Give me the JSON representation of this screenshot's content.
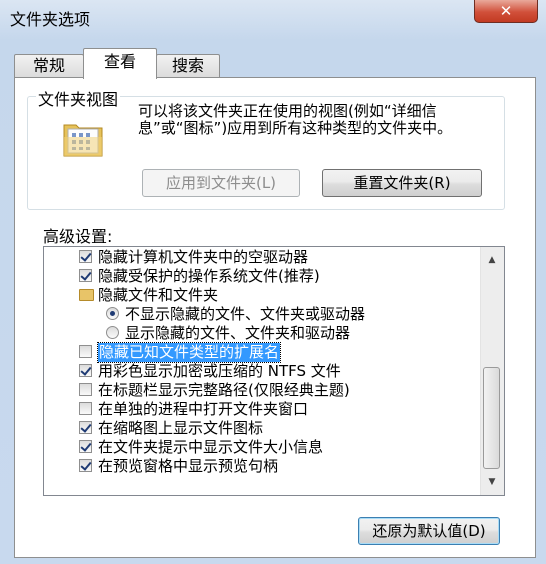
{
  "window": {
    "title": "文件夹选项",
    "close_glyph": "✕"
  },
  "tabs": [
    {
      "label": "常规",
      "active": false
    },
    {
      "label": "查看",
      "active": true
    },
    {
      "label": "搜索",
      "active": false
    }
  ],
  "folder_views": {
    "legend": "文件夹视图",
    "description": "可以将该文件夹正在使用的视图(例如“详细信息”或“图标”)应用到所有这种类型的文件夹中。",
    "apply_button": "应用到文件夹(L)",
    "reset_button": "重置文件夹(R)"
  },
  "advanced": {
    "label": "高级设置:",
    "items": [
      {
        "type": "checkbox",
        "checked": true,
        "indent": 1,
        "label": "隐藏计算机文件夹中的空驱动器"
      },
      {
        "type": "checkbox",
        "checked": true,
        "indent": 1,
        "label": "隐藏受保护的操作系统文件(推荐)"
      },
      {
        "type": "folder",
        "indent": 1,
        "label": "隐藏文件和文件夹"
      },
      {
        "type": "radio",
        "selected": true,
        "indent": 2,
        "label": "不显示隐藏的文件、文件夹或驱动器"
      },
      {
        "type": "radio",
        "selected": false,
        "indent": 2,
        "label": "显示隐藏的文件、文件夹和驱动器"
      },
      {
        "type": "checkbox",
        "checked": false,
        "indent": 1,
        "label": "隐藏已知文件类型的扩展名",
        "highlight": true
      },
      {
        "type": "checkbox",
        "checked": true,
        "indent": 1,
        "label": "用彩色显示加密或压缩的 NTFS 文件"
      },
      {
        "type": "checkbox",
        "checked": false,
        "indent": 1,
        "label": "在标题栏显示完整路径(仅限经典主题)"
      },
      {
        "type": "checkbox",
        "checked": false,
        "indent": 1,
        "label": "在单独的进程中打开文件夹窗口"
      },
      {
        "type": "checkbox",
        "checked": true,
        "indent": 1,
        "label": "在缩略图上显示文件图标"
      },
      {
        "type": "checkbox",
        "checked": true,
        "indent": 1,
        "label": "在文件夹提示中显示文件大小信息"
      },
      {
        "type": "checkbox",
        "checked": true,
        "indent": 1,
        "label": "在预览窗格中显示预览句柄"
      }
    ]
  },
  "restore_button": "还原为默认值(D)",
  "icons": {
    "scroll_up": "▲",
    "scroll_down": "▼"
  }
}
